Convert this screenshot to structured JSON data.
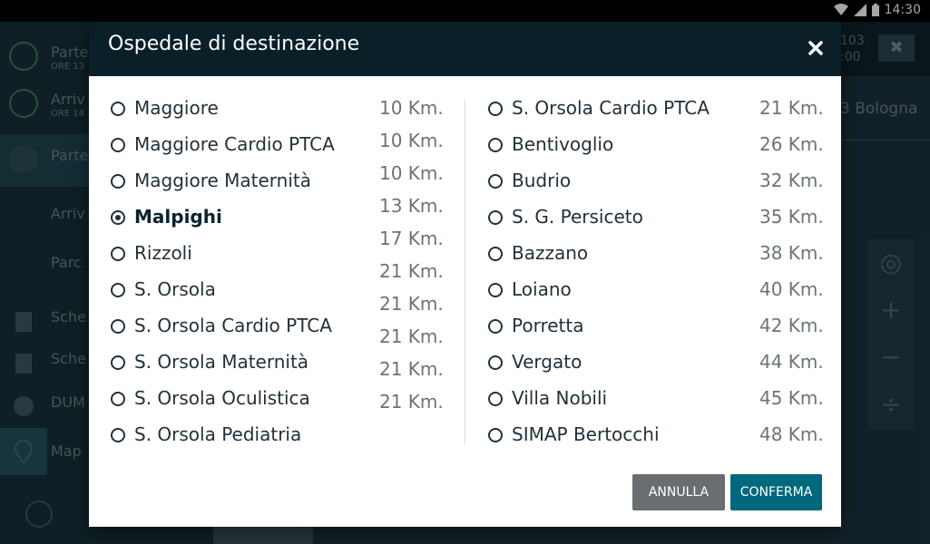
{
  "statusbar": {
    "time": "14:30"
  },
  "background": {
    "nav": [
      {
        "label": "Parte",
        "sub": "ORE 13"
      },
      {
        "label": "Arriv",
        "sub": "ORE 14"
      },
      {
        "label": "Parte",
        "sub": ""
      },
      {
        "label": "Arriv",
        "sub": ""
      },
      {
        "label": "Parc",
        "sub": ""
      },
      {
        "label": "Sche",
        "sub": ""
      },
      {
        "label": "Sche",
        "sub": ""
      },
      {
        "label": "DUM",
        "sub": ""
      },
      {
        "label": "Map",
        "sub": ""
      }
    ],
    "time_top": "103",
    "time_bottom": ":00",
    "location": "3 Bologna"
  },
  "dialog": {
    "title": "Ospedale di destinazione",
    "close_icon": "close-icon",
    "left_hospitals": [
      {
        "name": "Maggiore",
        "distance": "10 Km.",
        "selected": false
      },
      {
        "name": "Maggiore Cardio PTCA",
        "distance": "10 Km.",
        "selected": false
      },
      {
        "name": "Maggiore Maternità",
        "distance": "10 Km.",
        "selected": false
      },
      {
        "name": "Malpighi",
        "distance": "13 Km.",
        "selected": true
      },
      {
        "name": "Rizzoli",
        "distance": "17 Km.",
        "selected": false
      },
      {
        "name": "S. Orsola",
        "distance": "21 Km.",
        "selected": false
      },
      {
        "name": "S. Orsola Cardio PTCA",
        "distance": "21 Km.",
        "selected": false
      },
      {
        "name": "S. Orsola Maternità",
        "distance": "21 Km.",
        "selected": false
      },
      {
        "name": "S. Orsola Oculistica",
        "distance": "21 Km.",
        "selected": false
      },
      {
        "name": "S. Orsola Pediatria",
        "distance": "21 Km.",
        "selected": false
      }
    ],
    "right_hospitals": [
      {
        "name": "S. Orsola Cardio PTCA",
        "distance": "21 Km.",
        "selected": false
      },
      {
        "name": "Bentivoglio",
        "distance": "26 Km.",
        "selected": false
      },
      {
        "name": "Budrio",
        "distance": "32 Km.",
        "selected": false
      },
      {
        "name": "S. G. Persiceto",
        "distance": "35 Km.",
        "selected": false
      },
      {
        "name": "Bazzano",
        "distance": "38 Km.",
        "selected": false
      },
      {
        "name": "Loiano",
        "distance": "40 Km.",
        "selected": false
      },
      {
        "name": "Porretta",
        "distance": "42 Km.",
        "selected": false
      },
      {
        "name": "Vergato",
        "distance": "44 Km.",
        "selected": false
      },
      {
        "name": "Villa Nobili",
        "distance": "45 Km.",
        "selected": false
      },
      {
        "name": "SIMAP Bertocchi",
        "distance": "48 Km.",
        "selected": false
      }
    ],
    "cancel_label": "ANNULLA",
    "confirm_label": "CONFERMA"
  }
}
